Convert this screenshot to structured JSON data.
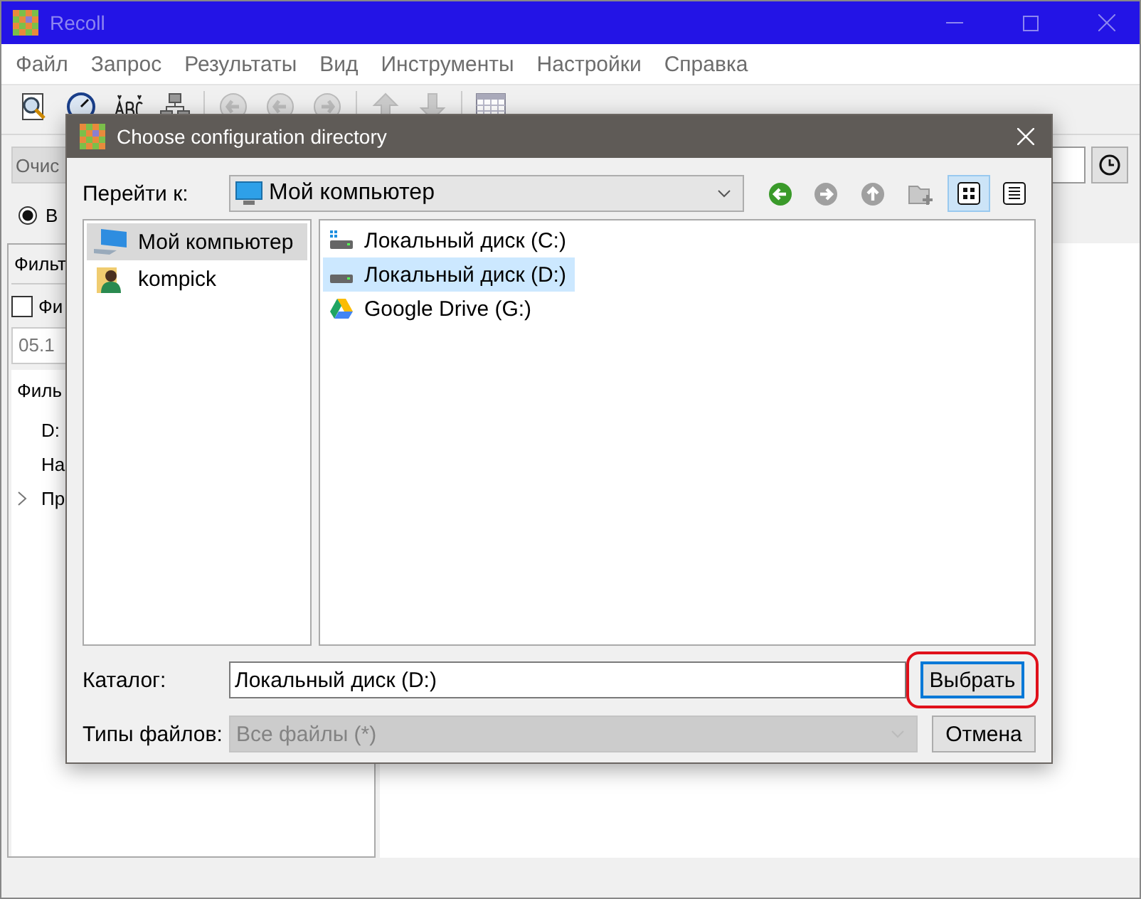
{
  "window": {
    "title": "Recoll"
  },
  "menu": [
    "Файл",
    "Запрос",
    "Результаты",
    "Вид",
    "Инструменты",
    "Настройки",
    "Справка"
  ],
  "main": {
    "clear_button": "Очис",
    "search_mode": {
      "label": "В",
      "selected": true
    },
    "filter_header": "Фильт",
    "date_filter": {
      "label": "Фи",
      "checked": false
    },
    "date_field": "05.1",
    "tree_header": "Филь",
    "tree": [
      {
        "label": "D:",
        "expandable": false
      },
      {
        "label": "На",
        "expandable": false
      },
      {
        "label": "Пр",
        "expandable": true
      }
    ]
  },
  "dialog": {
    "title": "Choose configuration directory",
    "look_in_label": "Перейти к:",
    "look_in": "Мой компьютер",
    "nav_buttons": [
      {
        "kind": "back",
        "disabled": false
      },
      {
        "kind": "forward",
        "disabled": true
      },
      {
        "kind": "up",
        "disabled": true
      },
      {
        "kind": "new_folder",
        "disabled": true
      }
    ],
    "view_buttons": [
      {
        "kind": "icons",
        "selected": true
      },
      {
        "kind": "details",
        "selected": false
      }
    ],
    "sidebar": [
      {
        "label": "Мой компьютер",
        "kind": "computer",
        "selected": true
      },
      {
        "label": "kompick",
        "kind": "user",
        "selected": false
      }
    ],
    "files": [
      {
        "label": "Локальный диск (C:)",
        "kind": "system_drive",
        "selected": false
      },
      {
        "label": "Локальный диск (D:)",
        "kind": "drive",
        "selected": true
      },
      {
        "label": "Google Drive (G:)",
        "kind": "cloud_drive",
        "selected": false
      }
    ],
    "directory_label": "Каталог:",
    "directory": "Локальный диск (D:)",
    "choose_button": {
      "label": "Выбрать",
      "focused": true,
      "circled": true
    },
    "file_types_label": "Типы файлов:",
    "file_types": {
      "value": "Все файлы (*)",
      "disabled": true
    },
    "cancel_button": "Отмена"
  }
}
